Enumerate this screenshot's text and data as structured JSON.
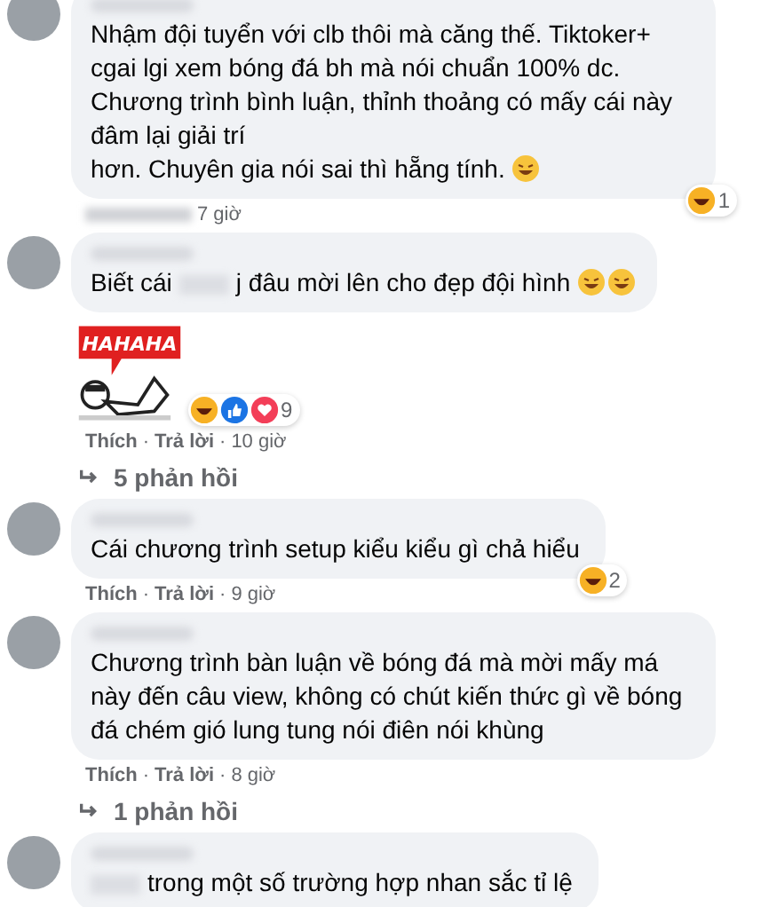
{
  "comments": [
    {
      "segments": [
        {
          "kind": "text",
          "text": "Nhậm đội tuyển với clb thôi mà căng thế. Tiktoker+ cgai lgi xem bóng đá bh mà nói chuẩn 100% dc. Chương trình bình luận, thỉnh thoảng có mấy cái này đâm lại giải trí"
        },
        {
          "kind": "line",
          "text": "hơn. Chuyên gia nói sai thì hẵng tính."
        },
        {
          "kind": "emoji"
        }
      ],
      "reactions": [
        {
          "kind": "haha"
        }
      ],
      "reaction_count": "1",
      "meta": [
        {
          "kind": "redacted"
        },
        {
          "kind": "time",
          "text": "7 giờ"
        }
      ]
    },
    {
      "segments": [
        {
          "kind": "text",
          "text": "Biết cái"
        },
        {
          "kind": "redacted"
        },
        {
          "kind": "text",
          "text": "j đâu mời lên cho đẹp đội hình"
        },
        {
          "kind": "emoji"
        },
        {
          "kind": "emoji"
        }
      ],
      "reactions": [
        {
          "kind": "haha"
        },
        {
          "kind": "like"
        },
        {
          "kind": "love"
        }
      ],
      "reaction_count": "9",
      "sticker": {
        "text": "HAHAHA"
      },
      "meta": [
        {
          "kind": "link",
          "text": "Thích"
        },
        {
          "kind": "sep",
          "text": "·"
        },
        {
          "kind": "link",
          "text": "Trả lời"
        },
        {
          "kind": "sep",
          "text": "·"
        },
        {
          "kind": "time",
          "text": "10 giờ"
        }
      ],
      "replies": "5 phản hồi"
    },
    {
      "segments": [
        {
          "kind": "text",
          "text": "Cái chương trình setup kiểu kiểu gì chả hiểu"
        }
      ],
      "reactions": [
        {
          "kind": "haha"
        }
      ],
      "reaction_count": "2",
      "meta": [
        {
          "kind": "link",
          "text": "Thích"
        },
        {
          "kind": "sep",
          "text": "·"
        },
        {
          "kind": "link",
          "text": "Trả lời"
        },
        {
          "kind": "sep",
          "text": "·"
        },
        {
          "kind": "time",
          "text": "9 giờ"
        }
      ]
    },
    {
      "segments": [
        {
          "kind": "text",
          "text": "Chương trình bàn luận về bóng đá mà mời mấy má này đến câu view, không có chút kiến thức gì về bóng đá chém gió lung tung nói điên nói khùng"
        }
      ],
      "meta": [
        {
          "kind": "link",
          "text": "Thích"
        },
        {
          "kind": "sep",
          "text": "·"
        },
        {
          "kind": "link",
          "text": "Trả lời"
        },
        {
          "kind": "sep",
          "text": "·"
        },
        {
          "kind": "time",
          "text": "8 giờ"
        }
      ],
      "replies": "1 phản hồi"
    },
    {
      "segments": [
        {
          "kind": "redacted"
        },
        {
          "kind": "text",
          "text": "trong một số trường hợp nhan sắc tỉ lệ"
        }
      ]
    }
  ]
}
